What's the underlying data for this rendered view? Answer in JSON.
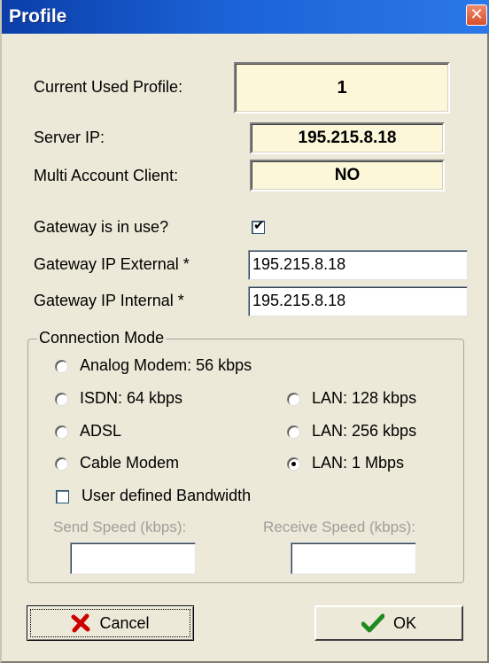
{
  "window": {
    "title": "Profile"
  },
  "fields": {
    "current_profile": {
      "label": "Current Used Profile:",
      "value": "1"
    },
    "server_ip": {
      "label": "Server IP:",
      "value": "195.215.8.18"
    },
    "multi_account": {
      "label": "Multi Account Client:",
      "value": "NO"
    },
    "gateway_in_use": {
      "label": "Gateway is in use?",
      "checked": true
    },
    "gateway_external": {
      "label": "Gateway IP External *",
      "value": "195.215.8.18"
    },
    "gateway_internal": {
      "label": "Gateway IP Internal *",
      "value": "195.215.8.18"
    }
  },
  "connection_mode": {
    "title": "Connection Mode",
    "options": [
      {
        "label": "Analog Modem: 56 kbps",
        "selected": false
      },
      {
        "label": "ISDN: 64 kbps",
        "selected": false
      },
      {
        "label": "ADSL",
        "selected": false
      },
      {
        "label": "Cable Modem",
        "selected": false
      },
      {
        "label": "LAN: 128 kbps",
        "selected": false
      },
      {
        "label": "LAN: 256 kbps",
        "selected": false
      },
      {
        "label": "LAN: 1 Mbps",
        "selected": true
      }
    ],
    "user_defined": {
      "label": "User defined Bandwidth",
      "checked": false
    },
    "send_speed": {
      "label": "Send Speed (kbps):",
      "value": ""
    },
    "receive_speed": {
      "label": "Receive Speed (kbps):",
      "value": ""
    }
  },
  "buttons": {
    "cancel": "Cancel",
    "ok": "OK"
  },
  "colors": {
    "title_bar": "#1a62d6",
    "dialog_bg": "#ece9d8",
    "readonly_field_bg": "#fbf7d8",
    "cancel_icon": "#cc0000",
    "ok_icon": "#1f8a1f"
  }
}
